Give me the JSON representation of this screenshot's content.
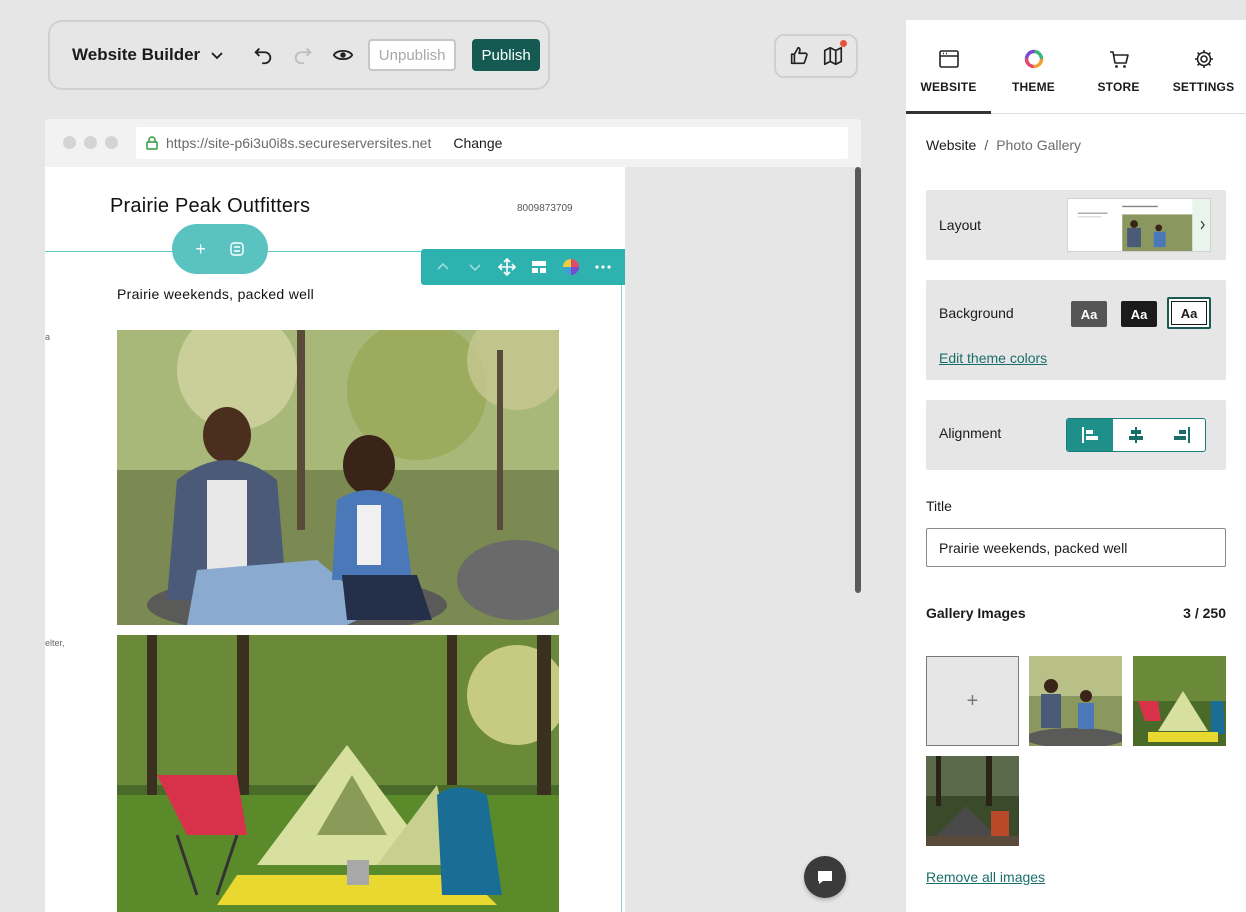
{
  "toolbar": {
    "title": "Website Builder",
    "unpublish_label": "Unpublish",
    "publish_label": "Publish",
    "icons": [
      "undo-icon",
      "redo-icon",
      "preview-eye-icon",
      "thumbs-up-icon",
      "map-icon"
    ]
  },
  "browser": {
    "url": "https://site-p6i3u0i8s.secureserversites.net",
    "change_label": "Change"
  },
  "site": {
    "name": "Prairie Peak Outfitters",
    "phone": "8009873709",
    "gallery_title": "Prairie weekends, packed well",
    "fragment_1": "a",
    "fragment_2": "elter,"
  },
  "panel": {
    "tabs": [
      {
        "label": "WEBSITE",
        "icon": "website-icon",
        "active": true
      },
      {
        "label": "THEME",
        "icon": "theme-ring-icon",
        "active": false
      },
      {
        "label": "STORE",
        "icon": "cart-icon",
        "active": false
      },
      {
        "label": "SETTINGS",
        "icon": "gear-icon",
        "active": false
      }
    ],
    "breadcrumb": {
      "root": "Website",
      "separator": "/",
      "current": "Photo Gallery"
    },
    "layout_label": "Layout",
    "background": {
      "label": "Background",
      "swatches": [
        {
          "text": "Aa",
          "bg": "#555555",
          "fg": "#ffffff"
        },
        {
          "text": "Aa",
          "bg": "#1b1b1b",
          "fg": "#ffffff"
        },
        {
          "text": "Aa",
          "bg": "#ffffff",
          "fg": "#1b1b1b",
          "selected": true
        }
      ],
      "edit_link": "Edit theme colors"
    },
    "alignment_label": "Alignment",
    "title_label": "Title",
    "title_value": "Prairie weekends, packed well",
    "gallery_images_label": "Gallery Images",
    "gallery_count": "3 / 250",
    "add_symbol": "+",
    "remove_link": "Remove all images"
  },
  "colors": {
    "accent": "#145a52",
    "teal": "#2db2b0",
    "link": "#1a6e6a"
  }
}
